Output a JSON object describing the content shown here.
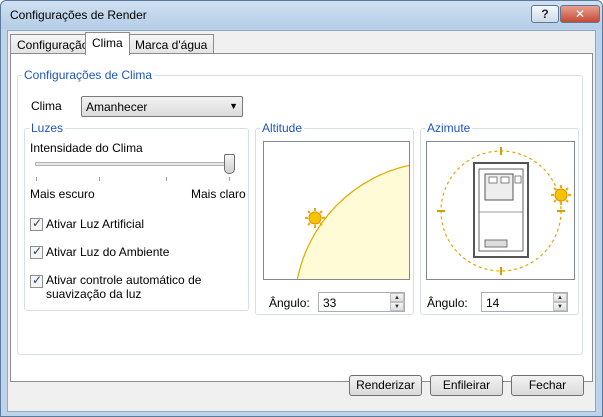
{
  "window": {
    "title": "Configurações de Render",
    "help_label": "?",
    "close_label": "✕"
  },
  "tabs": [
    {
      "label": "Configuração"
    },
    {
      "label": "Clima"
    },
    {
      "label": "Marca d'água"
    }
  ],
  "climate_group": {
    "caption": "Configurações de Clima",
    "clima_label": "Clima",
    "clima_value": "Amanhecer"
  },
  "lights_group": {
    "caption": "Luzes",
    "intensity_label": "Intensidade do Clima",
    "intensity_level": 1.0,
    "min_label": "Mais escuro",
    "max_label": "Mais claro",
    "checkboxes": [
      {
        "label": "Ativar Luz Artificial",
        "checked": true
      },
      {
        "label": "Ativar Luz do Ambiente",
        "checked": true
      },
      {
        "label": "Ativar controle automático de suavização da luz",
        "checked": true
      }
    ]
  },
  "altitude_group": {
    "caption": "Altitude",
    "angle_label": "Ângulo:",
    "angle_value": "33"
  },
  "azimute_group": {
    "caption": "Azimute",
    "angle_label": "Ângulo:",
    "angle_value": "14"
  },
  "footer": {
    "render_label": "Renderizar",
    "queue_label": "Enfileirar",
    "close_label": "Fechar"
  },
  "colors": {
    "accent_text": "#1e54c5",
    "sun": "#f5c400",
    "orbit": "#e0a800",
    "sky_fill": "#fffbd6"
  }
}
